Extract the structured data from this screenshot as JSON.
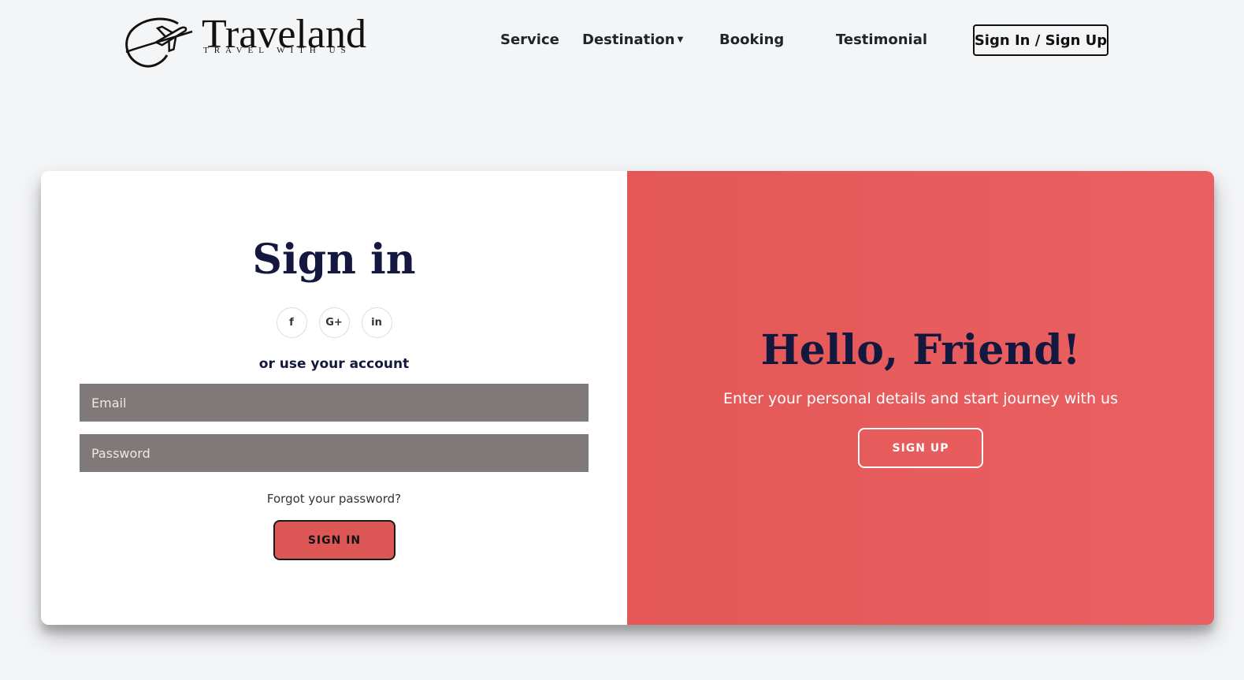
{
  "header": {
    "logo": {
      "name": "Traveland",
      "tagline": "TRAVEL WITH US"
    },
    "nav": {
      "service": "Service",
      "destination": "Destination",
      "booking": "Booking",
      "testimonial": "Testimonial",
      "signin_signup": "Sign In / Sign Up"
    }
  },
  "signin": {
    "title": "Sign in",
    "social": {
      "facebook": "f",
      "google": "G+",
      "linkedin": "in"
    },
    "or_text": "or use your account",
    "email_placeholder": "Email",
    "password_placeholder": "Password",
    "forgot": "Forgot your password?",
    "button": "SIGN IN"
  },
  "overlay": {
    "title": "Hello, Friend!",
    "text": "Enter your personal details and start journey with us",
    "button": "SIGN UP"
  },
  "colors": {
    "page_bg": "#f4f5f7",
    "accent": "#e45756",
    "heading": "#14183e",
    "field_bg": "#807979"
  },
  "icons": [
    "airplane-logo-icon",
    "caret-down-icon",
    "facebook-icon",
    "google-plus-icon",
    "linkedin-icon"
  ]
}
